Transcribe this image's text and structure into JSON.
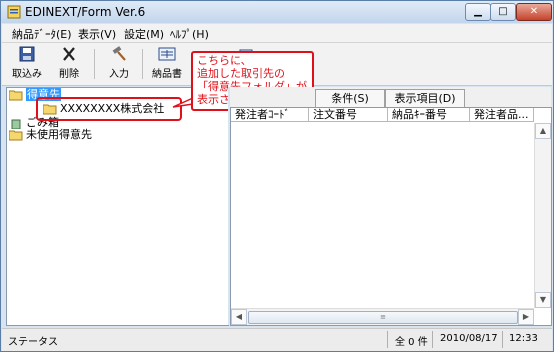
{
  "window": {
    "title": "EDINEXT/Form Ver.6"
  },
  "menubar": {
    "items": [
      "納品ﾃﾞｰﾀ(E)",
      "表示(V)",
      "設定(M)",
      "ﾍﾙﾌﾟ(H)"
    ]
  },
  "toolbar": {
    "import_label": "取込み",
    "delete_label": "削除",
    "input_label": "入力",
    "delivery_note_label": "納品書"
  },
  "tree": {
    "root_label": "得意先",
    "child_label": "XXXXXXXX株式会社",
    "trash_label": "ごみ箱",
    "unused_label": "未使用得意先"
  },
  "callout": {
    "lines": [
      "こちらに、",
      "追加した取引先の",
      "「得意先フォルダ」が",
      "表示されます。"
    ]
  },
  "tabs": [
    "条件(S)",
    "表示項目(D)"
  ],
  "table": {
    "columns": [
      "発注者ｺｰﾄﾞ",
      "注文番号",
      "納品ｷｰ番号",
      "発注者品..."
    ]
  },
  "status": {
    "label": "ステータス",
    "count": "全 0 件",
    "date": "2010/08/17",
    "time": "12:33"
  }
}
